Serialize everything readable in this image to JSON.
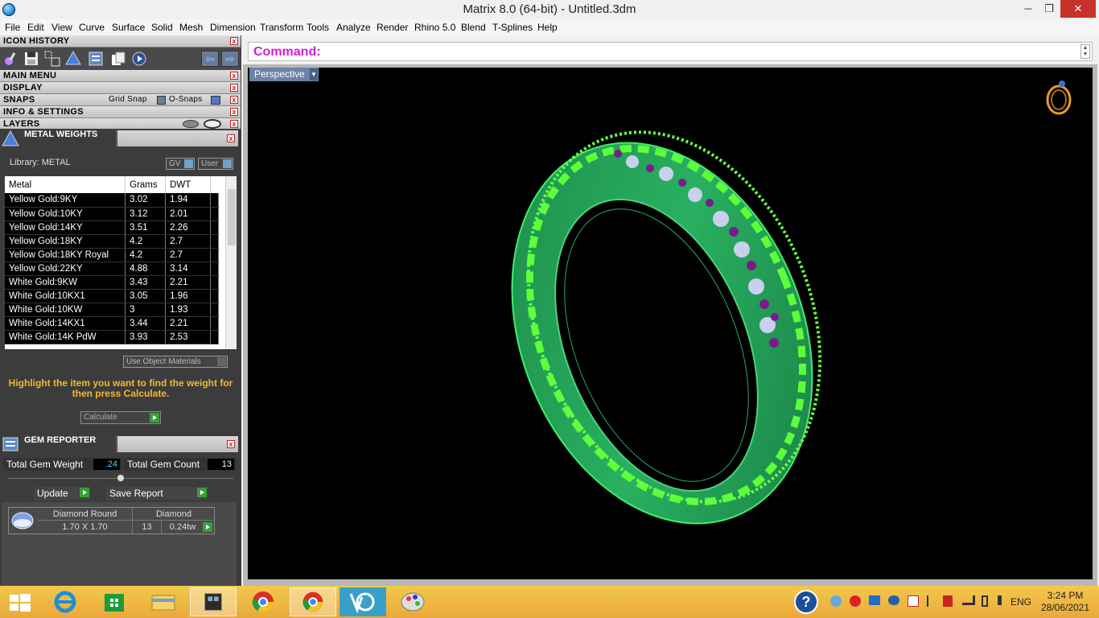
{
  "window": {
    "title": "Matrix 8.0 (64-bit) - Untitled.3dm",
    "minimize_glyph": "─",
    "restore_glyph": "❐",
    "close_glyph": "✕"
  },
  "menu": [
    "File",
    "Edit",
    "View",
    "Curve",
    "Surface",
    "Solid",
    "Mesh",
    "Dimension",
    "Transform",
    "Tools",
    "Analyze",
    "Render",
    "Rhino 5.0",
    "Blend",
    "T-Splines",
    "Help"
  ],
  "panels": {
    "icon_history": "ICON HISTORY",
    "main_menu": "MAIN MENU",
    "display": "DISPLAY",
    "snaps": "SNAPS",
    "grid_snap": "Grid Snap",
    "o_snaps": "O-Snaps",
    "info_settings": "INFO & SETTINGS",
    "layers": "LAYERS",
    "close_glyph": "x",
    "nav_back": "⇦",
    "nav_fwd": "⇨"
  },
  "metal_weights": {
    "title": "METAL WEIGHTS",
    "library": "Library: METAL",
    "gv_label": "GV",
    "user_label": "User",
    "columns": [
      "Metal",
      "Grams",
      "DWT"
    ],
    "rows": [
      [
        "Yellow Gold:9KY",
        "3.02",
        "1.94"
      ],
      [
        "Yellow Gold:10KY",
        "3.12",
        "2.01"
      ],
      [
        "Yellow Gold:14KY",
        "3.51",
        "2.26"
      ],
      [
        "Yellow Gold:18KY",
        "4.2",
        "2.7"
      ],
      [
        "Yellow Gold:18KY Royal",
        "4.2",
        "2.7"
      ],
      [
        "Yellow Gold:22KY",
        "4.88",
        "3.14"
      ],
      [
        "White Gold:9KW",
        "3.43",
        "2.21"
      ],
      [
        "White Gold:10KX1",
        "3.05",
        "1.96"
      ],
      [
        "White Gold:10KW",
        "3",
        "1.93"
      ],
      [
        "White Gold:14KX1",
        "3.44",
        "2.21"
      ],
      [
        "White Gold:14K PdW",
        "3.93",
        "2.53"
      ]
    ],
    "use_object_materials": "Use Object Materials",
    "hint": "Highlight the item you want to find the weight for then press Calculate.",
    "calculate": "Calculate"
  },
  "gem_reporter": {
    "title": "GEM REPORTER",
    "total_weight_label": "Total Gem Weight",
    "total_weight": ".24",
    "total_count_label": "Total Gem Count",
    "total_count": "13",
    "update": "Update",
    "save_report": "Save Report",
    "gem_shape": "Diamond Round",
    "gem_type": "Diamond",
    "gem_size": "1.70 X 1.70",
    "gem_count": "13",
    "gem_weight": "0.24tw"
  },
  "command": {
    "label": "Command:",
    "value": ""
  },
  "viewport": {
    "name": "Perspective",
    "dropdown_glyph": "▼"
  },
  "taskbar": {
    "language": "ENG",
    "time": "3:24 PM",
    "date": "28/06/2021",
    "help_glyph": "?"
  },
  "colors": {
    "command_label": "#d41fd4",
    "hint_text": "#f3b833",
    "ring_green": "#27c46a",
    "ring_bright": "#48f03a",
    "gem_purple": "#7a1a8c",
    "gem_white": "#c8d0ee",
    "taskbar": "#f0b940"
  }
}
